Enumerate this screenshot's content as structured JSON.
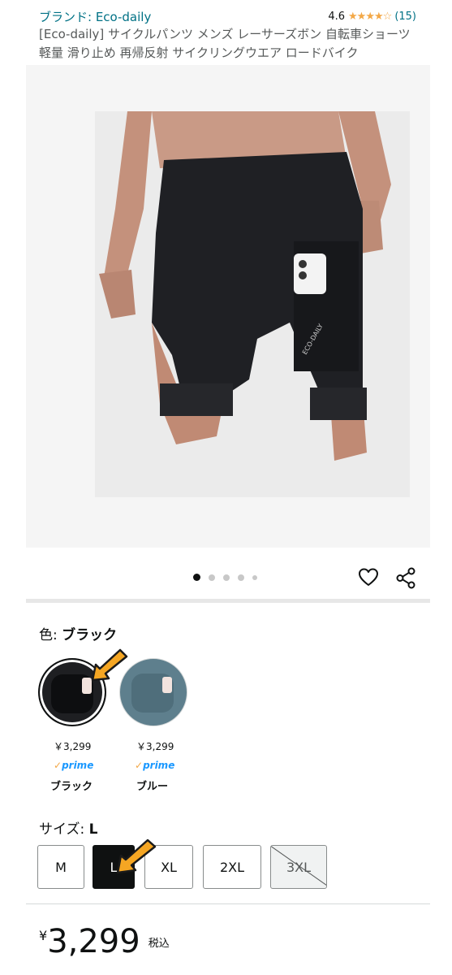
{
  "brand": {
    "link_text": "ブランド: Eco-daily"
  },
  "rating": {
    "score": "4.6",
    "stars": "★★★★☆",
    "count": "(15)"
  },
  "product": {
    "title": "[Eco-daily] サイクルパンツ メンズ レーサーズボン 自転車ショーツ 軽量 滑り止め 再帰反射 サイクリングウエア ロードバイク"
  },
  "gallery": {
    "total_images": 5,
    "active_index": 1
  },
  "actions": {
    "heart_icon": "heart-icon",
    "share_icon": "share-icon"
  },
  "color": {
    "label_prefix": "色: ",
    "selected": "ブラック",
    "options": [
      {
        "name": "ブラック",
        "price": "￥3,299",
        "prime_check": "✓",
        "prime": "prime",
        "swatch_color": "#1e1f22"
      },
      {
        "name": "ブルー",
        "price": "￥3,299",
        "prime_check": "✓",
        "prime": "prime",
        "swatch_color": "#5e7f8d"
      }
    ]
  },
  "size": {
    "label_prefix": "サイズ: ",
    "selected": "L",
    "options": [
      {
        "label": "M",
        "state": "available"
      },
      {
        "label": "L",
        "state": "selected"
      },
      {
        "label": "XL",
        "state": "available"
      },
      {
        "label": "2XL",
        "state": "available"
      },
      {
        "label": "3XL",
        "state": "unavailable"
      }
    ]
  },
  "price": {
    "symbol": "¥",
    "amount": "3,299",
    "tax_note": "税込"
  },
  "colors": {
    "accent_link": "#007185",
    "star": "#f3a847",
    "prime_blue": "#1a98ff",
    "arrow_orange": "#f5a623"
  }
}
